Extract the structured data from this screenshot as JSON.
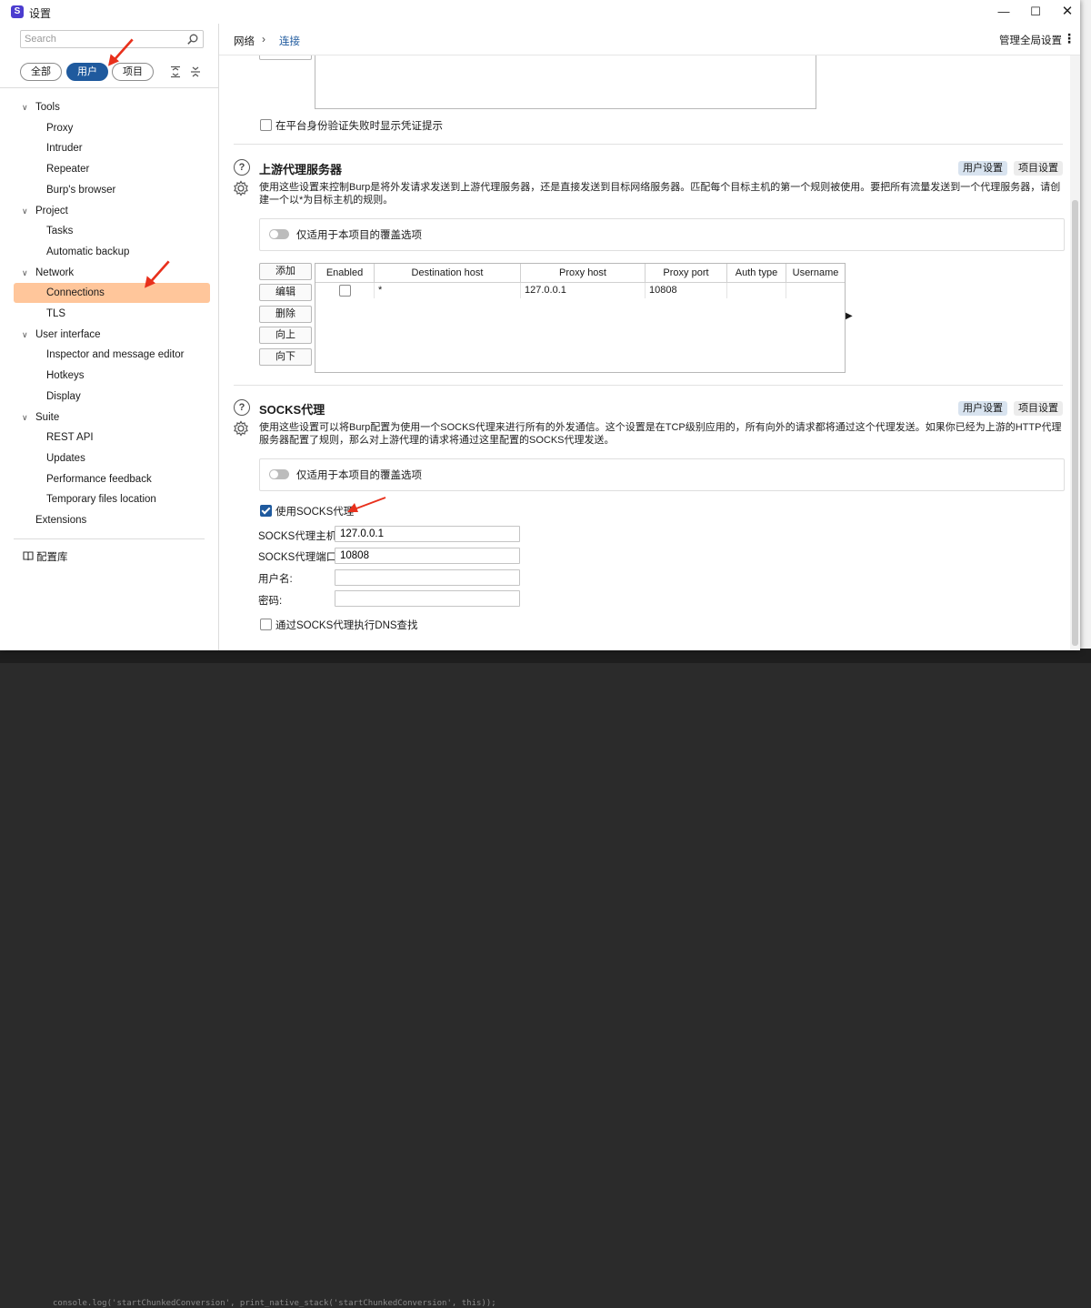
{
  "window": {
    "title": "设置",
    "logo_glyph": "S"
  },
  "background": {
    "code_line": "console.log('startChunkedConversion', print_native_stack('startChunkedConversion', this));"
  },
  "sidebar": {
    "search_placeholder": "Search",
    "filters": [
      {
        "label": "全部",
        "active": false
      },
      {
        "label": "用户",
        "active": true
      },
      {
        "label": "项目",
        "active": false
      }
    ],
    "tree": [
      {
        "label": "Tools",
        "level": 0,
        "expanded": true
      },
      {
        "label": "Proxy",
        "level": 1
      },
      {
        "label": "Intruder",
        "level": 1
      },
      {
        "label": "Repeater",
        "level": 1
      },
      {
        "label": "Burp's browser",
        "level": 1
      },
      {
        "label": "Project",
        "level": 0,
        "expanded": true
      },
      {
        "label": "Tasks",
        "level": 1
      },
      {
        "label": "Automatic backup",
        "level": 1
      },
      {
        "label": "Network",
        "level": 0,
        "expanded": true
      },
      {
        "label": "Connections",
        "level": 1,
        "selected": true
      },
      {
        "label": "TLS",
        "level": 1
      },
      {
        "label": "User interface",
        "level": 0,
        "expanded": true
      },
      {
        "label": "Inspector and message editor",
        "level": 1
      },
      {
        "label": "Hotkeys",
        "level": 1
      },
      {
        "label": "Display",
        "level": 1
      },
      {
        "label": "Suite",
        "level": 0,
        "expanded": true
      },
      {
        "label": "REST API",
        "level": 1
      },
      {
        "label": "Updates",
        "level": 1
      },
      {
        "label": "Performance feedback",
        "level": 1
      },
      {
        "label": "Temporary files location",
        "level": 1
      },
      {
        "label": "Extensions",
        "level": 0,
        "expanded": false
      }
    ],
    "library_label": "配置库"
  },
  "header": {
    "breadcrumb": [
      "网络",
      "连接"
    ],
    "manage_global": "管理全局设置",
    "more_glyph": "⋮"
  },
  "top_partial": {
    "checkbox_label": "在平台身份验证失败时显示凭证提示"
  },
  "upstream": {
    "title": "上游代理服务器",
    "badge_user": "用户设置",
    "badge_project": "项目设置",
    "description": "使用这些设置来控制Burp是将外发请求发送到上游代理服务器，还是直接发送到目标网络服务器。匹配每个目标主机的第一个规则被使用。要把所有流量发送到一个代理服务器，请创建一个以*为目标主机的规则。",
    "override_label": "仅适用于本项目的覆盖选项",
    "buttons": [
      "添加",
      "编辑",
      "删除",
      "向上",
      "向下"
    ],
    "columns": [
      "Enabled",
      "Destination host",
      "Proxy host",
      "Proxy port",
      "Auth type",
      "Username"
    ],
    "rows": [
      {
        "enabled": false,
        "destination_host": "*",
        "proxy_host": "127.0.0.1",
        "proxy_port": "10808",
        "auth_type": "",
        "username": ""
      }
    ]
  },
  "socks": {
    "title": "SOCKS代理",
    "badge_user": "用户设置",
    "badge_project": "项目设置",
    "description": "使用这些设置可以将Burp配置为使用一个SOCKS代理来进行所有的外发通信。这个设置是在TCP级别应用的，所有向外的请求都将通过这个代理发送。如果你已经为上游的HTTP代理服务器配置了规则，那么对上游代理的请求将通过这里配置的SOCKS代理发送。",
    "override_label": "仅适用于本项目的覆盖选项",
    "use_socks_label": "使用SOCKS代理",
    "use_socks_checked": true,
    "host_label": "SOCKS代理主机:",
    "host_value": "127.0.0.1",
    "port_label": "SOCKS代理端口:",
    "port_value": "10808",
    "username_label": "用户名:",
    "username_value": "",
    "password_label": "密码:",
    "password_value": "",
    "dns_label": "通过SOCKS代理执行DNS查找",
    "dns_checked": false
  },
  "colors": {
    "accent": "#1f5a9e",
    "selected_bg": "#ffc69b",
    "annotation_arrow": "#e8301c"
  }
}
